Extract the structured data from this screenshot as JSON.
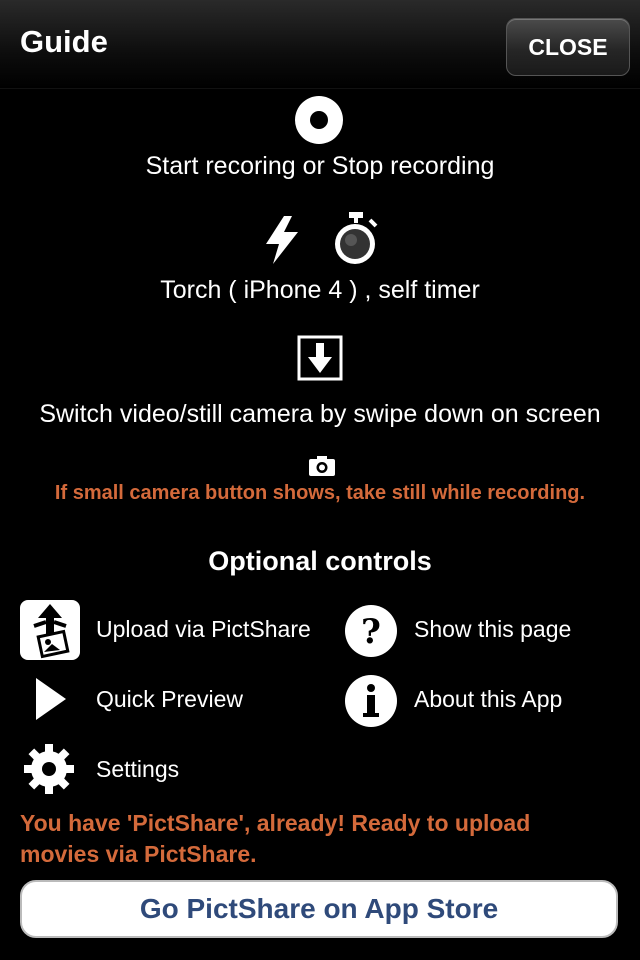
{
  "navbar": {
    "title": "Guide",
    "close_label": "CLOSE"
  },
  "guide": {
    "record_text": "Start recoring or Stop recording",
    "torch_text": "Torch ( iPhone 4 ) , self timer",
    "switch_text": "Switch video/still camera by swipe down on screen",
    "still_text": "If small camera button shows, take still while recording."
  },
  "optional": {
    "heading": "Optional controls",
    "items": [
      {
        "label": "Upload via PictShare",
        "icon": "upload-icon"
      },
      {
        "label": "Show this page",
        "icon": "help-icon"
      },
      {
        "label": "Quick Preview",
        "icon": "play-icon"
      },
      {
        "label": "About this App",
        "icon": "info-icon"
      },
      {
        "label": "Settings",
        "icon": "gear-icon"
      }
    ]
  },
  "notice": {
    "line1": "You have 'PictShare', already! Ready to upload",
    "line2": "movies via PictShare."
  },
  "store_button": {
    "label": "Go PictShare on App Store"
  },
  "colors": {
    "accent": "#d46a3b",
    "button_text": "#2f4a7a"
  }
}
